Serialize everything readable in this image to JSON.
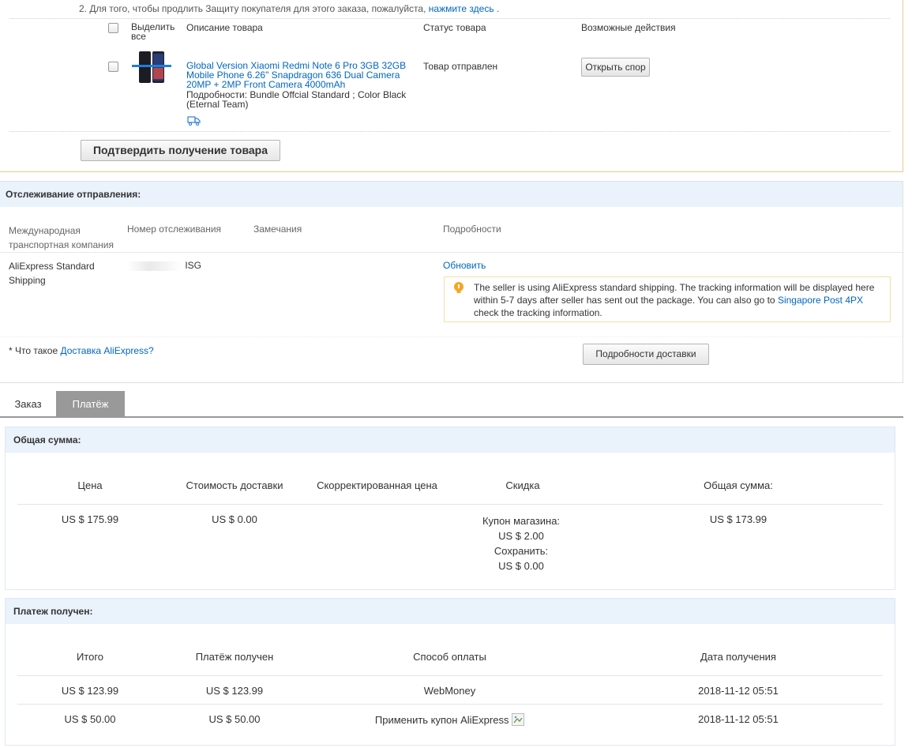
{
  "notice_line": {
    "text": "2. Для того, чтобы продлить Защиту покупателя для этого заказа, пожалуйста,",
    "link": "нажмите здесь",
    "suffix": "."
  },
  "order_table": {
    "headers": {
      "select": "Выделить все",
      "description": "Описание товара",
      "status": "Статус товара",
      "actions": "Возможные действия"
    },
    "item": {
      "title": "Global Version Xiaomi Redmi Note 6 Pro 3GB 32GB Mobile Phone 6.26\" Snapdragon 636 Dual Camera 20MP + 2MP Front Camera 4000mAh",
      "details": "Подробности: Bundle Offcial Standard   ; Color Black (Eternal Team)",
      "status": "Товар отправлен",
      "action_button": "Открыть спор"
    },
    "confirm_button": "Подтвердить получение товара"
  },
  "tracking": {
    "title": "Отслеживание отправления:",
    "headers": {
      "company": "Международная транспортная компания",
      "number": "Номер отслеживания",
      "remarks": "Замечания",
      "details": "Подробности"
    },
    "row": {
      "company": "AliExpress Standard Shipping",
      "number": "ISG",
      "update_link": "Обновить"
    },
    "notice": {
      "text1": "The seller is using AliExpress standard shipping. The tracking information will be displayed here within 5-7 days after seller has sent out the package. You can also go to",
      "link": "Singapore Post 4PX",
      "text2": "check the tracking information."
    },
    "footnote_prefix": "* Что такое",
    "footnote_link": "Доставка AliExpress?",
    "details_button": "Подробности доставки"
  },
  "tabs": [
    {
      "label": "Заказ",
      "active": false
    },
    {
      "label": "Платёж",
      "active": true
    }
  ],
  "totals": {
    "title": "Общая сумма:",
    "headers": [
      "Цена",
      "Стоимость доставки",
      "Скорректированная цена",
      "Скидка",
      "Общая сумма:"
    ],
    "price": "US $ 175.99",
    "shipping": "US $ 0.00",
    "adjusted": "",
    "discount": {
      "coupon_label": "Купон магазина:",
      "coupon_value": "US $ 2.00",
      "save_label": "Сохранить:",
      "save_value": "US $ 0.00"
    },
    "total": "US $ 173.99"
  },
  "payment": {
    "title": "Платеж получен:",
    "headers": [
      "Итого",
      "Платёж получен",
      "Способ оплаты",
      "Дата получения"
    ],
    "rows": [
      {
        "total": "US $ 123.99",
        "received": "US $ 123.99",
        "method": "WebMoney",
        "date": "2018-11-12 05:51"
      },
      {
        "total": "US $ 50.00",
        "received": "US $ 50.00",
        "method": "Применить купон AliExpress",
        "date": "2018-11-12 05:51"
      }
    ]
  },
  "colors": {
    "link": "#0066c0",
    "section_header_bg": "#eaf2fb",
    "active_tab_bg": "#999999",
    "order_border": "#f0c987"
  }
}
